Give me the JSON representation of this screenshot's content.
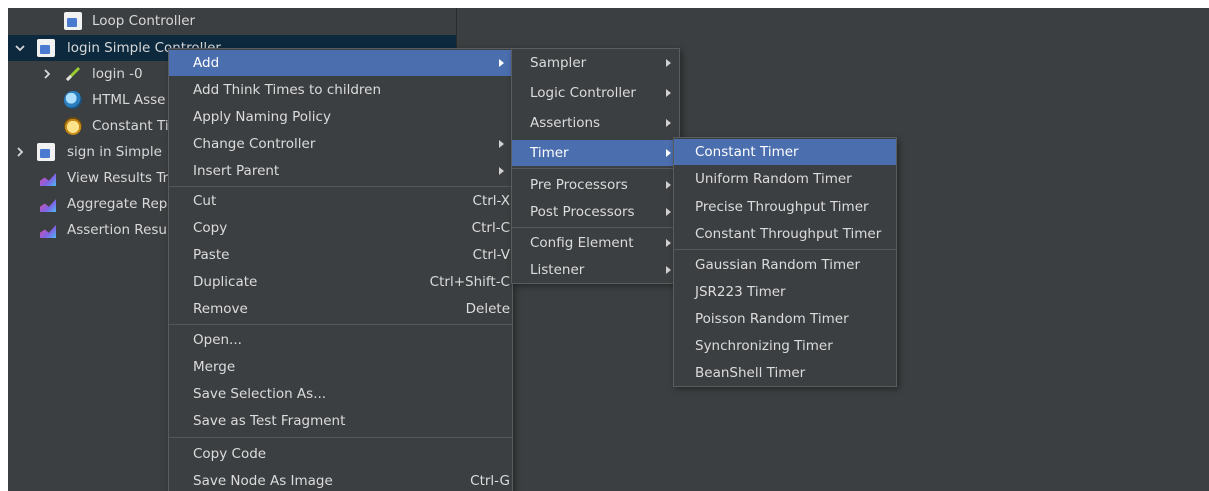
{
  "tree": {
    "items": [
      {
        "label": "Loop Controller",
        "icon": "controller-icon"
      },
      {
        "label": "login Simple Controller",
        "icon": "controller-icon"
      },
      {
        "label": "login -0",
        "icon": "sampler-icon"
      },
      {
        "label": "HTML Asse",
        "icon": "assertion-icon"
      },
      {
        "label": "Constant Ti",
        "icon": "timer-icon"
      },
      {
        "label": "sign in Simple",
        "icon": "controller-icon"
      },
      {
        "label": "View Results Tr",
        "icon": "listener-chart-icon"
      },
      {
        "label": "Aggregate Rep",
        "icon": "listener-chart-icon"
      },
      {
        "label": "Assertion Resul",
        "icon": "listener-chart-icon"
      }
    ]
  },
  "context_menu": {
    "items": [
      {
        "label": "Add",
        "shortcut": "",
        "submenu": true,
        "highlighted": true
      },
      {
        "label": "Add Think Times to children",
        "shortcut": ""
      },
      {
        "label": "Apply Naming Policy",
        "shortcut": ""
      },
      {
        "label": "Change Controller",
        "shortcut": "",
        "submenu": true
      },
      {
        "label": "Insert Parent",
        "shortcut": "",
        "submenu": true
      },
      {
        "label": "Cut",
        "shortcut": "Ctrl-X"
      },
      {
        "label": "Copy",
        "shortcut": "Ctrl-C"
      },
      {
        "label": "Paste",
        "shortcut": "Ctrl-V"
      },
      {
        "label": "Duplicate",
        "shortcut": "Ctrl+Shift-C"
      },
      {
        "label": "Remove",
        "shortcut": "Delete"
      },
      {
        "label": "Open...",
        "shortcut": ""
      },
      {
        "label": "Merge",
        "shortcut": ""
      },
      {
        "label": "Save Selection As...",
        "shortcut": ""
      },
      {
        "label": "Save as Test Fragment",
        "shortcut": ""
      },
      {
        "label": "Copy Code",
        "shortcut": ""
      },
      {
        "label": "Save Node As Image",
        "shortcut": "Ctrl-G"
      }
    ]
  },
  "add_submenu": {
    "items": [
      {
        "label": "Sampler"
      },
      {
        "label": "Logic Controller"
      },
      {
        "label": "Assertions"
      },
      {
        "label": "Timer",
        "highlighted": true
      },
      {
        "label": "Pre Processors"
      },
      {
        "label": "Post Processors"
      },
      {
        "label": "Config Element"
      },
      {
        "label": "Listener"
      }
    ]
  },
  "timer_submenu": {
    "items": [
      {
        "label": "Constant Timer",
        "highlighted": true
      },
      {
        "label": "Uniform Random Timer"
      },
      {
        "label": "Precise Throughput Timer"
      },
      {
        "label": "Constant Throughput Timer"
      },
      {
        "label": "Gaussian Random Timer"
      },
      {
        "label": "JSR223 Timer"
      },
      {
        "label": "Poisson Random Timer"
      },
      {
        "label": "Synchronizing Timer"
      },
      {
        "label": "BeanShell Timer"
      }
    ]
  },
  "colors": {
    "background": "#3c3f41",
    "menu_highlight": "#4b6eaf",
    "tree_selection": "#0d293e",
    "text": "#dcdcdc"
  }
}
